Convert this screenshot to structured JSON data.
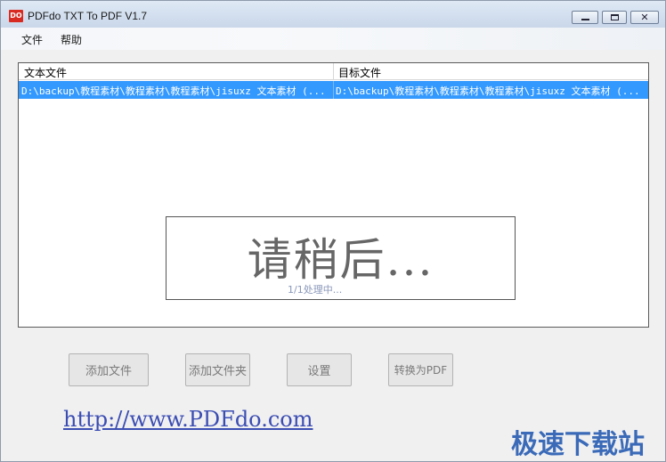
{
  "window": {
    "title": "PDFdo TXT To PDF V1.7",
    "icon_label": "DO"
  },
  "menu": {
    "file": "文件",
    "help": "帮助"
  },
  "list": {
    "columns": [
      "文本文件",
      "目标文件"
    ],
    "rows": [
      {
        "source": "D:\\backup\\教程素材\\教程素材\\教程素材\\jisuxz 文本素材 (...",
        "target": "D:\\backup\\教程素材\\教程素材\\教程素材\\jisuxz 文本素材 (...",
        "selected": true
      }
    ]
  },
  "wait_dialog": {
    "message": "请稍后...",
    "progress": "1/1处理中..."
  },
  "buttons": {
    "add_file": "添加文件",
    "add_folder": "添加文件夹",
    "settings": "设置",
    "convert": "转换为PDF"
  },
  "website": "http://www.PDFdo.com",
  "watermark": "极速下载站",
  "colors": {
    "selection": "#3399ff",
    "link": "#3b4db3",
    "watermark": "#3a6ab8"
  }
}
